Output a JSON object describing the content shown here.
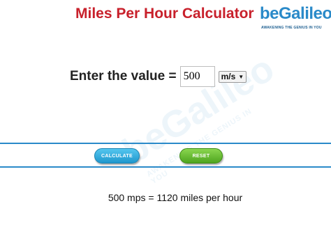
{
  "header": {
    "title": "Miles Per Hour Calculator"
  },
  "logo": {
    "name": "beGalileo",
    "tagline": "AWAKENING THE GENIUS IN YOU",
    "color": "#2a8ac9"
  },
  "form": {
    "label": "Enter the value =",
    "value": "500",
    "unit_selected": "m/s"
  },
  "buttons": {
    "calculate": "CALCULATE",
    "reset": "RESET",
    "calculate_color": "#29a3d8",
    "reset_color": "#5db52a"
  },
  "result": {
    "text": "500 mps = 1120 miles per hour"
  },
  "watermark": {
    "name": "beGalileo",
    "tagline": "AWAKENING THE GENIUS IN YOU"
  },
  "accent": {
    "title_color": "#c8202b",
    "band_color": "#2a8ac9"
  }
}
